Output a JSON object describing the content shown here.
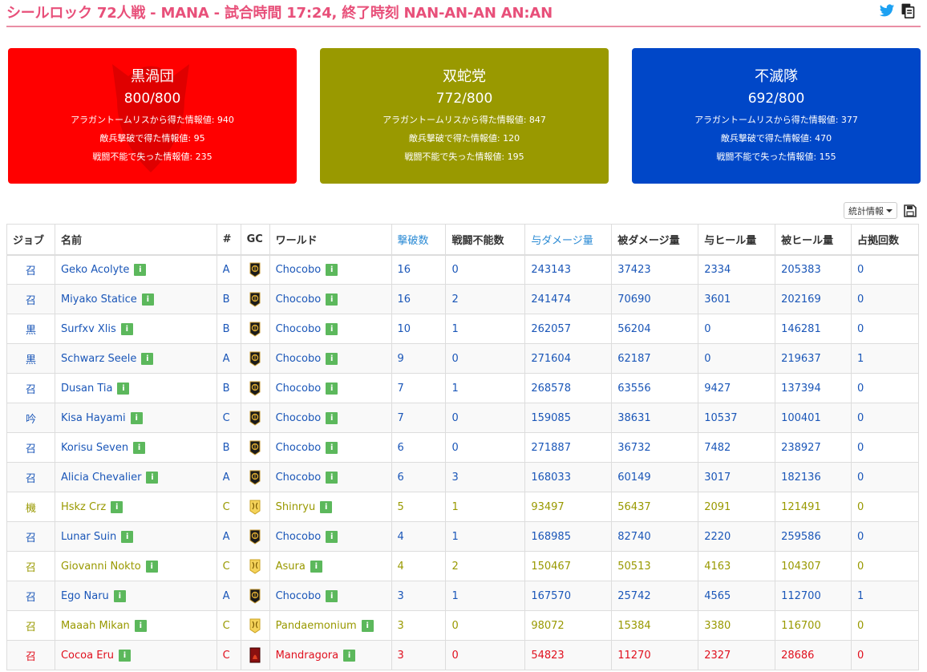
{
  "header": {
    "title": "シールロック 72人戦 - MANA - 試合時間 17:24, 終了時刻 NAN-AN-AN AN:AN"
  },
  "teams": [
    {
      "name": "黒渦団",
      "score": "800/800",
      "info_aragant": "アラガントームリスから得た情報値: 940",
      "info_enemy": "敵兵撃破で得た情報値: 95",
      "info_lost": "戦闘不能で失った情報値: 235",
      "color": "#ff0000"
    },
    {
      "name": "双蛇党",
      "score": "772/800",
      "info_aragant": "アラガントームリスから得た情報値: 847",
      "info_enemy": "敵兵撃破で得た情報値: 120",
      "info_lost": "戦闘不能で失った情報値: 195",
      "color": "#999900"
    },
    {
      "name": "不滅隊",
      "score": "692/800",
      "info_aragant": "アラガントームリスから得た情報値: 377",
      "info_enemy": "敵兵撃破で得た情報値: 470",
      "info_lost": "戦闘不能で失った情報値: 155",
      "color": "#0047c8"
    }
  ],
  "toolbar": {
    "stats_label": "統計情報"
  },
  "table": {
    "headers": [
      "ジョブ",
      "名前",
      "#",
      "GC",
      "ワールド",
      "撃破数",
      "戦闘不能数",
      "与ダメージ量",
      "被ダメージ量",
      "与ヒール量",
      "被ヒール量",
      "占拠回数"
    ],
    "info_label": "i",
    "rows": [
      {
        "job": "召",
        "name": "Geko Acolyte",
        "party": "A",
        "gc": "maelstrom",
        "world": "Chocobo",
        "kills": "16",
        "deaths": "0",
        "dmg_dealt": "243143",
        "dmg_taken": "37423",
        "heal_dealt": "2334",
        "heal_taken": "205383",
        "captures": "0"
      },
      {
        "job": "召",
        "name": "Miyako Statice",
        "party": "B",
        "gc": "maelstrom",
        "world": "Chocobo",
        "kills": "16",
        "deaths": "2",
        "dmg_dealt": "241474",
        "dmg_taken": "70690",
        "heal_dealt": "3601",
        "heal_taken": "202169",
        "captures": "0"
      },
      {
        "job": "黒",
        "name": "Surfxv Xlis",
        "party": "B",
        "gc": "maelstrom",
        "world": "Chocobo",
        "kills": "10",
        "deaths": "1",
        "dmg_dealt": "262057",
        "dmg_taken": "56204",
        "heal_dealt": "0",
        "heal_taken": "146281",
        "captures": "0"
      },
      {
        "job": "黒",
        "name": "Schwarz Seele",
        "party": "A",
        "gc": "maelstrom",
        "world": "Chocobo",
        "kills": "9",
        "deaths": "0",
        "dmg_dealt": "271604",
        "dmg_taken": "62187",
        "heal_dealt": "0",
        "heal_taken": "219637",
        "captures": "1"
      },
      {
        "job": "召",
        "name": "Dusan Tia",
        "party": "B",
        "gc": "maelstrom",
        "world": "Chocobo",
        "kills": "7",
        "deaths": "1",
        "dmg_dealt": "268578",
        "dmg_taken": "63556",
        "heal_dealt": "9427",
        "heal_taken": "137394",
        "captures": "0"
      },
      {
        "job": "吟",
        "name": "Kisa Hayami",
        "party": "C",
        "gc": "maelstrom",
        "world": "Chocobo",
        "kills": "7",
        "deaths": "0",
        "dmg_dealt": "159085",
        "dmg_taken": "38631",
        "heal_dealt": "10537",
        "heal_taken": "100401",
        "captures": "0"
      },
      {
        "job": "召",
        "name": "Korisu Seven",
        "party": "B",
        "gc": "maelstrom",
        "world": "Chocobo",
        "kills": "6",
        "deaths": "0",
        "dmg_dealt": "271887",
        "dmg_taken": "36732",
        "heal_dealt": "7482",
        "heal_taken": "238927",
        "captures": "0"
      },
      {
        "job": "召",
        "name": "Alicia Chevalier",
        "party": "A",
        "gc": "maelstrom",
        "world": "Chocobo",
        "kills": "6",
        "deaths": "3",
        "dmg_dealt": "168033",
        "dmg_taken": "60149",
        "heal_dealt": "3017",
        "heal_taken": "182136",
        "captures": "0"
      },
      {
        "job": "機",
        "name": "Hskz Crz",
        "party": "C",
        "gc": "twin-adder",
        "world": "Shinryu",
        "kills": "5",
        "deaths": "1",
        "dmg_dealt": "93497",
        "dmg_taken": "56437",
        "heal_dealt": "2091",
        "heal_taken": "121491",
        "captures": "0"
      },
      {
        "job": "召",
        "name": "Lunar Suin",
        "party": "A",
        "gc": "maelstrom",
        "world": "Chocobo",
        "kills": "4",
        "deaths": "1",
        "dmg_dealt": "168985",
        "dmg_taken": "82740",
        "heal_dealt": "2220",
        "heal_taken": "259586",
        "captures": "0"
      },
      {
        "job": "召",
        "name": "Giovanni Nokto",
        "party": "C",
        "gc": "twin-adder",
        "world": "Asura",
        "kills": "4",
        "deaths": "2",
        "dmg_dealt": "150467",
        "dmg_taken": "50513",
        "heal_dealt": "4163",
        "heal_taken": "104307",
        "captures": "0"
      },
      {
        "job": "召",
        "name": "Ego Naru",
        "party": "A",
        "gc": "maelstrom",
        "world": "Chocobo",
        "kills": "3",
        "deaths": "1",
        "dmg_dealt": "167570",
        "dmg_taken": "25742",
        "heal_dealt": "4565",
        "heal_taken": "112700",
        "captures": "1"
      },
      {
        "job": "召",
        "name": "Maaah Mikan",
        "party": "C",
        "gc": "twin-adder",
        "world": "Pandaemonium",
        "kills": "3",
        "deaths": "0",
        "dmg_dealt": "98072",
        "dmg_taken": "15384",
        "heal_dealt": "3380",
        "heal_taken": "116700",
        "captures": "0"
      },
      {
        "job": "召",
        "name": "Cocoa Eru",
        "party": "C",
        "gc": "immortal-flames",
        "world": "Mandragora",
        "kills": "3",
        "deaths": "0",
        "dmg_dealt": "54823",
        "dmg_taken": "11270",
        "heal_dealt": "2327",
        "heal_taken": "28686",
        "captures": "0"
      }
    ]
  }
}
